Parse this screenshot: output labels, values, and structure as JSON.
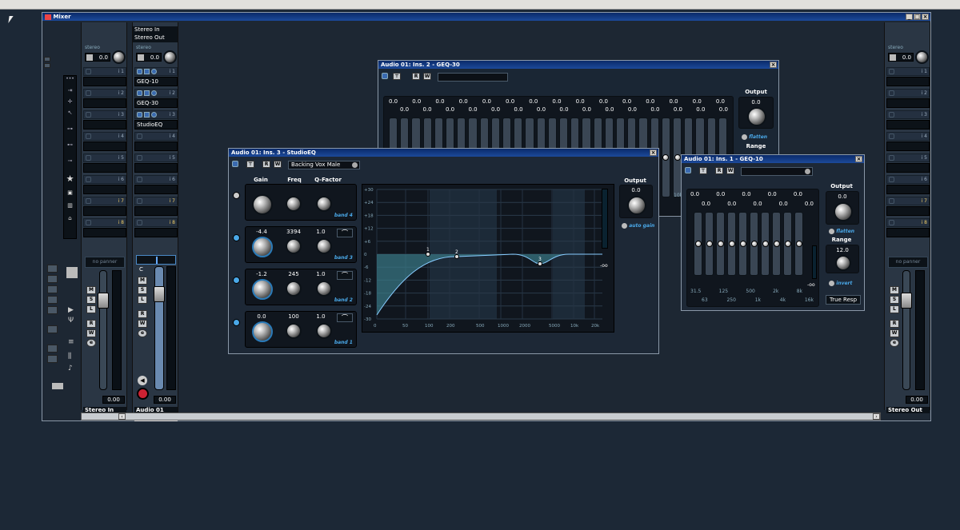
{
  "mixer": {
    "title": "Mixer",
    "left_strip": {
      "stereo_label": "stereo",
      "pan_value": "0.0",
      "panner_text": "no panner",
      "fader_value": "0.00",
      "name": "Stereo In",
      "inserts": [
        "i 1",
        "i 2",
        "i 3",
        "i 4",
        "i 5",
        "i 6",
        "i 7",
        "i 8"
      ],
      "buttons": [
        "M",
        "S",
        "L",
        "R",
        "W",
        "e"
      ]
    },
    "audio_strip": {
      "routing_in": "Stereo In",
      "routing_out": "Stereo Out",
      "stereo_label": "stereo",
      "pan_value": "0.0",
      "pan_label": "C",
      "fader_value": "0.00",
      "name": "Audio 01",
      "name_field": "1",
      "inserts": [
        {
          "name": "GEQ-10",
          "num": "i 1"
        },
        {
          "name": "GEQ-30",
          "num": "i 2"
        },
        {
          "name": "StudioEQ",
          "num": "i 3"
        },
        {
          "name": "",
          "num": "i 4"
        },
        {
          "name": "",
          "num": "i 5"
        },
        {
          "name": "",
          "num": "i 6"
        },
        {
          "name": "",
          "num": "i 7"
        },
        {
          "name": "",
          "num": "i 8"
        }
      ],
      "buttons": [
        "M",
        "S",
        "L",
        "R",
        "W",
        "e"
      ]
    },
    "right_strip": {
      "stereo_label": "stereo",
      "pan_value": "0.0",
      "panner_text": "no panner",
      "fader_value": "0.00",
      "name": "Stereo Out",
      "inserts": [
        "i 1",
        "i 2",
        "i 3",
        "i 4",
        "i 5",
        "i 6",
        "i 7",
        "i 8"
      ],
      "buttons": [
        "M",
        "S",
        "L",
        "R",
        "W",
        "e"
      ]
    }
  },
  "geq30": {
    "title": "Audio 01: Ins. 2 - GEQ-30",
    "output_label": "Output",
    "output_value": "0.0",
    "flatten_label": "flatten",
    "range_label": "Range",
    "top_values": [
      "0.0",
      "0.0",
      "0.0",
      "0.0",
      "0.0",
      "0.0",
      "0.0",
      "0.0",
      "0.0",
      "0.0",
      "0.0",
      "0.0",
      "0.0",
      "0.0",
      "0.0"
    ],
    "bottom_values": [
      "0.0",
      "0.0",
      "0.0",
      "0.0",
      "0.0",
      "0.0",
      "0.0",
      "0.0",
      "0.0",
      "0.0",
      "0.0",
      "0.0",
      "0.0",
      "0.0",
      "0.0"
    ],
    "freq_label": "10k"
  },
  "studioeq": {
    "title": "Audio 01: Ins. 3 - StudioEQ",
    "preset": "Backing Vox Male",
    "col_gain": "Gain",
    "col_freq": "Freq",
    "col_q": "Q-Factor",
    "bands": [
      {
        "label": "band 4",
        "gain": "",
        "freq": "",
        "q": ""
      },
      {
        "label": "band 3",
        "gain": "-4.4",
        "freq": "3394",
        "q": "1.0"
      },
      {
        "label": "band 2",
        "gain": "-1.2",
        "freq": "245",
        "q": "1.0"
      },
      {
        "label": "band 1",
        "gain": "0.0",
        "freq": "100",
        "q": "1.0"
      }
    ],
    "output_label": "Output",
    "output_value": "0.0",
    "auto_gain": "auto gain",
    "meter_inf": "-oo",
    "y_ticks": [
      "+30",
      "+24",
      "+18",
      "+12",
      "+6",
      "0",
      "-6",
      "-12",
      "-18",
      "-24",
      "-30"
    ],
    "x_ticks": [
      "0",
      "50",
      "100",
      "200",
      "500",
      "1000",
      "2000",
      "5000",
      "10k",
      "20k"
    ],
    "points": [
      "1",
      "2",
      "3"
    ]
  },
  "geq10": {
    "title": "Audio 01: Ins. 1 - GEQ-10",
    "output_label": "Output",
    "output_value": "0.0",
    "flatten_label": "flatten",
    "range_label": "Range",
    "range_value": "12.0",
    "invert_label": "invert",
    "true_resp": "True Resp",
    "meter_inf": "-oo",
    "top_values": [
      "0.0",
      "0.0",
      "0.0",
      "0.0",
      "0.0"
    ],
    "bottom_values": [
      "0.0",
      "0.0",
      "0.0",
      "0.0",
      "0.0"
    ],
    "freq_top": [
      "31.5",
      "125",
      "500",
      "2k",
      "8k"
    ],
    "freq_bottom": [
      "63",
      "250",
      "1k",
      "4k",
      "16k"
    ]
  }
}
